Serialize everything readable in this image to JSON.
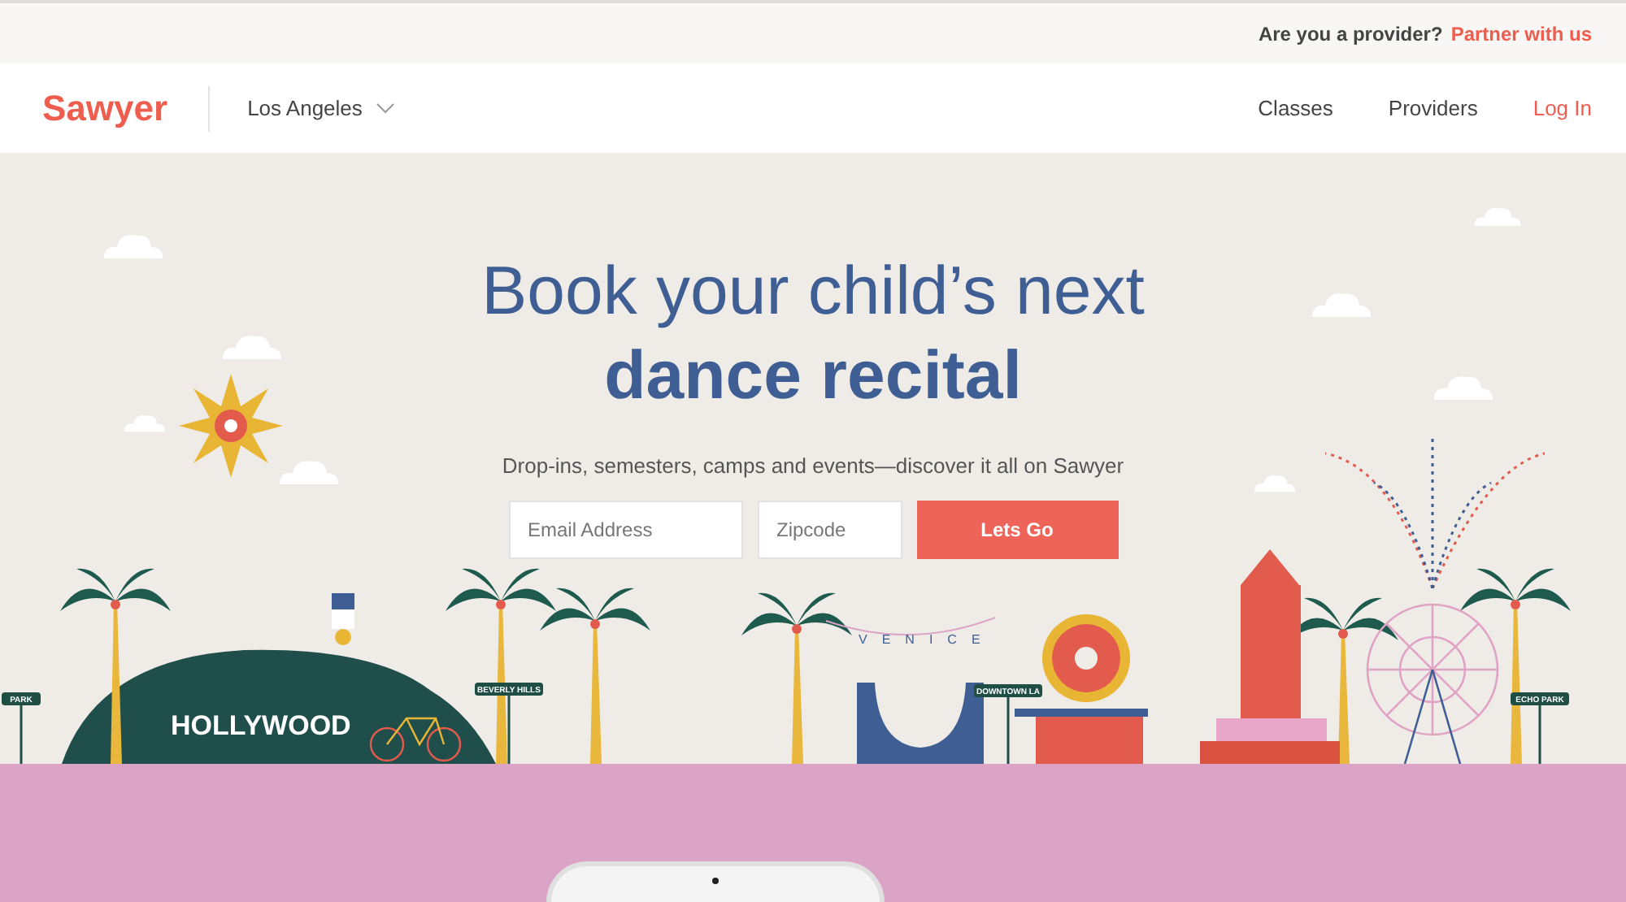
{
  "top_bar": {
    "question": "Are you a provider?",
    "link": "Partner with us"
  },
  "nav": {
    "logo": "Sawyer",
    "city": "Los Angeles",
    "links": [
      {
        "label": "Classes",
        "kind": "plain"
      },
      {
        "label": "Providers",
        "kind": "plain"
      },
      {
        "label": "Log In",
        "kind": "accent"
      }
    ]
  },
  "hero": {
    "title_line_1": "Book your child’s next",
    "title_line_2": "dance recital",
    "subtitle": "Drop-ins, semesters, camps and events—discover it all on Sawyer",
    "email_placeholder": "Email Address",
    "zipcode_placeholder": "Zipcode",
    "button": "Lets Go"
  },
  "illustration_signs": [
    "PARK",
    "HOLLYWOOD",
    "BEVERLY HILLS",
    "VENICE",
    "DOWNTOWN LA",
    "ECHO PARK"
  ]
}
